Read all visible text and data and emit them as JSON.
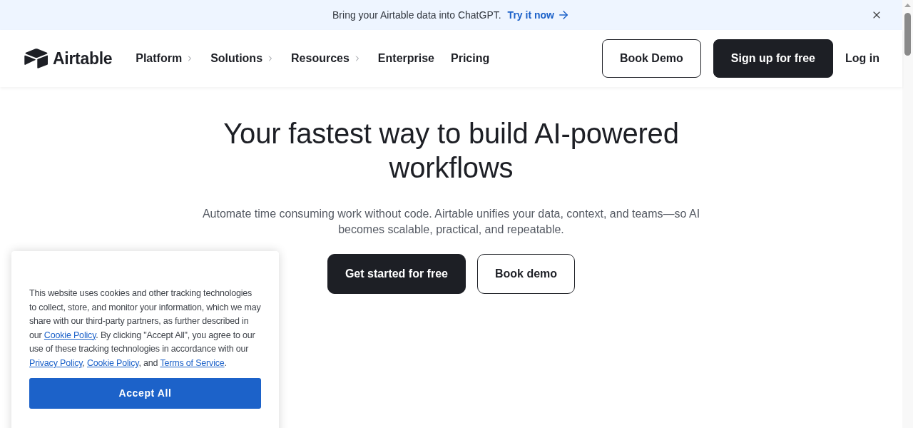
{
  "banner": {
    "message": "Bring your Airtable data into ChatGPT.",
    "link": "Try it now"
  },
  "nav": {
    "logo": "Airtable",
    "items": [
      {
        "label": "Platform",
        "kind": "menu"
      },
      {
        "label": "Solutions",
        "kind": "menu"
      },
      {
        "label": "Resources",
        "kind": "menu"
      },
      {
        "label": "Enterprise",
        "kind": "link"
      },
      {
        "label": "Pricing",
        "kind": "link"
      }
    ],
    "actions": [
      {
        "label": "Book Demo",
        "kind": "outline"
      },
      {
        "label": "Sign up for free",
        "kind": "solid"
      },
      {
        "label": "Log in",
        "kind": "text"
      }
    ]
  },
  "hero": {
    "title": "Your fastest way to build AI-powered workflows",
    "subtitle": "Automate time consuming work without code. Airtable unifies your data, context, and teams—so AI becomes scalable, practical, and repeatable.",
    "buttons": [
      {
        "label": "Get started for free",
        "kind": "solid"
      },
      {
        "label": "Book demo",
        "kind": "outline"
      }
    ]
  },
  "cookie_notice": {
    "text": [
      {
        "kind": "text",
        "text": "This website uses cookies and other tracking technologies to collect, store, and monitor your information, which we may share with our third-party partners, as further described in our "
      },
      {
        "kind": "link",
        "text": "Cookie Policy"
      },
      {
        "kind": "text",
        "text": ". By clicking \"Accept All\", you agree to our use of these tracking technologies in accordance with our "
      },
      {
        "kind": "link",
        "text": "Privacy Policy"
      },
      {
        "kind": "text",
        "text": ", "
      },
      {
        "kind": "link",
        "text": "Cookie Policy"
      },
      {
        "kind": "text",
        "text": ", and "
      },
      {
        "kind": "link",
        "text": "Terms of Service"
      },
      {
        "kind": "text",
        "text": "."
      }
    ],
    "button": "Accept All"
  }
}
